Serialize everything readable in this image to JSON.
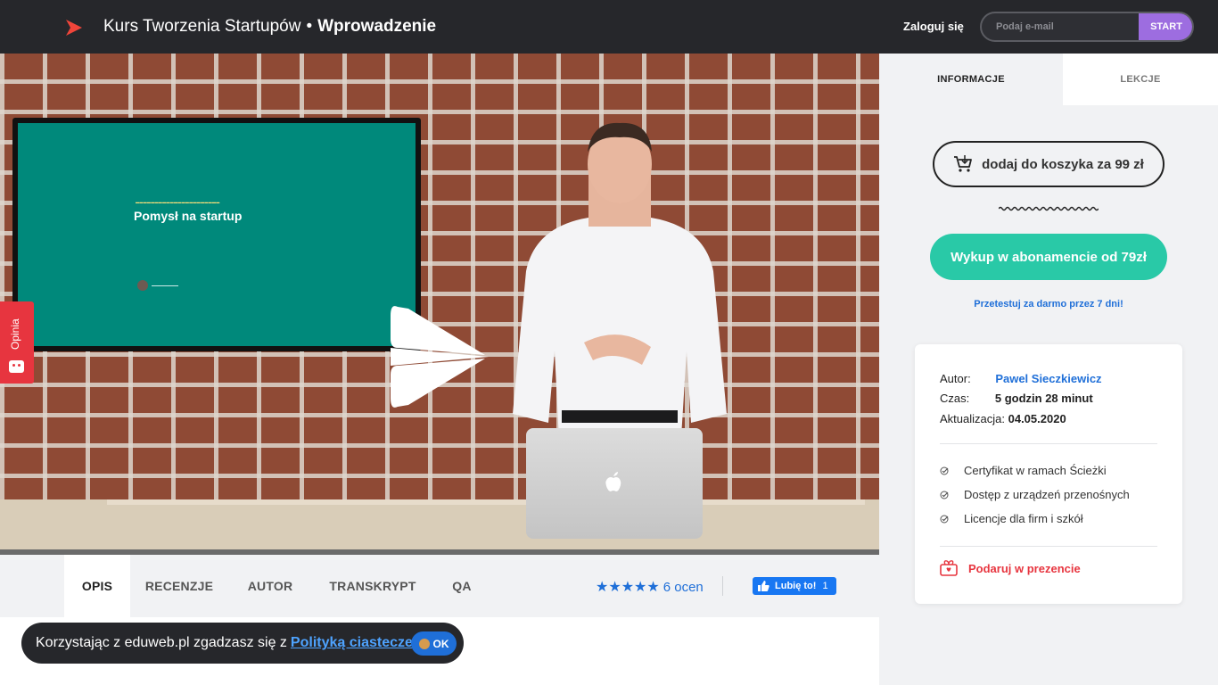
{
  "header": {
    "course_name": "Kurs Tworzenia Startupów",
    "separator": "•",
    "lesson_name": "Wprowadzenie",
    "login_label": "Zaloguj się",
    "email_placeholder": "Podaj e-mail",
    "start_label": "START",
    "accent_color": "#9d6de0"
  },
  "video": {
    "slide_title": "Pomysł na startup",
    "play_icon": "play-icon"
  },
  "opinia": {
    "label": "Opinia"
  },
  "tabs": [
    {
      "label": "OPIS",
      "active": true
    },
    {
      "label": "RECENZJE",
      "active": false
    },
    {
      "label": "AUTOR",
      "active": false
    },
    {
      "label": "TRANSKRYPT",
      "active": false
    },
    {
      "label": "QA",
      "active": false
    }
  ],
  "rating": {
    "stars": "★★★★★",
    "count_label": "6 ocen",
    "value": 5
  },
  "facebook": {
    "label": "Lubię to!",
    "count": "1"
  },
  "cookie": {
    "text": "Korzystając z eduweb.pl zgadzasz się z",
    "link": "Polityką ciasteczek",
    "ok": "OK"
  },
  "sidebar": {
    "tabs": [
      {
        "label": "INFORMACJE",
        "active": true
      },
      {
        "label": "LEKCJE",
        "active": false
      }
    ],
    "cart_label": "dodaj do koszyka za 99 zł",
    "subscription_label": "Wykup w abonamencie od 79zł",
    "trial_label": "Przetestuj za darmo przez 7 dni!",
    "subscription_color": "#29c9a7",
    "info": {
      "author_label": "Autor:",
      "author_value": "Pawel Sieczkiewicz",
      "time_label": "Czas:",
      "time_value": "5 godzin 28 minut",
      "updated_label": "Aktualizacja:",
      "updated_value": "04.05.2020"
    },
    "features": [
      "Certyfikat w ramach Ścieżki",
      "Dostęp z urządzeń przenośnych",
      "Licencje dla firm i szkół"
    ],
    "gift_label": "Podaruj w prezencie"
  }
}
